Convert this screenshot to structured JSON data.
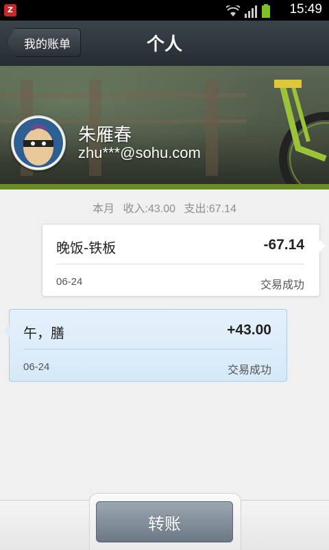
{
  "status_bar": {
    "time": "15:49",
    "icons": [
      "app-notification-icon",
      "wifi-icon",
      "signal-icon",
      "battery-icon"
    ]
  },
  "header": {
    "back_label": "我的账单",
    "title": "个人"
  },
  "profile": {
    "name": "朱雁春",
    "email": "zhu***@sohu.com"
  },
  "summary": {
    "period": "本月",
    "income": "收入:43.00",
    "expense": "支出:67.14"
  },
  "transactions": [
    {
      "title": "晚饭-铁板",
      "amount": "-67.14",
      "date": "06-24",
      "status": "交易成功",
      "direction": "out"
    },
    {
      "title": "午，膳",
      "amount": "+43.00",
      "date": "06-24",
      "status": "交易成功",
      "direction": "in"
    }
  ],
  "footer": {
    "transfer_label": "转账"
  },
  "colors": {
    "accent_green": "#6a8a23",
    "income_card": "#d6e9f8",
    "button": "#7d8a96"
  }
}
